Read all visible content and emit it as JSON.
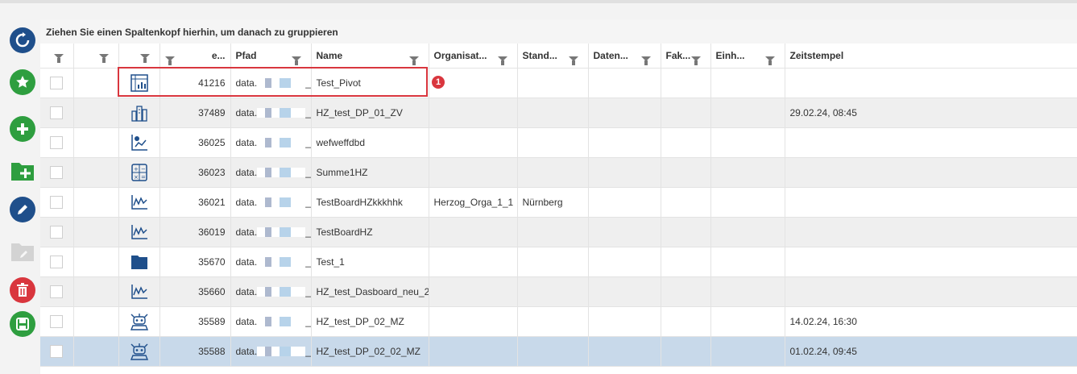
{
  "grid": {
    "group_hint": "Ziehen Sie einen Spaltenkopf hierhin, um danach zu gruppieren",
    "columns": [
      "e...",
      "Pfad",
      "Name",
      "Organisat...",
      "Stand...",
      "Daten...",
      "Fak...",
      "Einh...",
      "Zeitstempel"
    ],
    "rows": [
      {
        "icon": "pivot-table-icon",
        "id": "41216",
        "pfad": "data.",
        "pfad_suffix": "_Test",
        "name": "Test_Pivot",
        "org": "",
        "stand": "",
        "zeit": ""
      },
      {
        "icon": "building-icon",
        "id": "37489",
        "pfad": "data.",
        "pfad_suffix": "_Test",
        "name": "HZ_test_DP_01_ZV",
        "org": "",
        "stand": "",
        "zeit": "29.02.24, 08:45"
      },
      {
        "icon": "scatter-chart-icon",
        "id": "36025",
        "pfad": "data.",
        "pfad_suffix": "_Test",
        "name": "wefweffdbd",
        "org": "",
        "stand": "",
        "zeit": ""
      },
      {
        "icon": "calculator-icon",
        "id": "36023",
        "pfad": "data.",
        "pfad_suffix": "_Test",
        "name": "Summe1HZ",
        "org": "",
        "stand": "",
        "zeit": ""
      },
      {
        "icon": "line-chart-icon",
        "id": "36021",
        "pfad": "data.",
        "pfad_suffix": "_Test",
        "name": "TestBoardHZkkkhhk",
        "org": "Herzog_Orga_1_1",
        "stand": "Nürnberg",
        "zeit": ""
      },
      {
        "icon": "line-chart-icon",
        "id": "36019",
        "pfad": "data.",
        "pfad_suffix": "_Test",
        "name": "TestBoardHZ",
        "org": "",
        "stand": "",
        "zeit": ""
      },
      {
        "icon": "folder-icon",
        "id": "35670",
        "pfad": "data.",
        "pfad_suffix": "_Test",
        "name": "Test_1",
        "org": "",
        "stand": "",
        "zeit": ""
      },
      {
        "icon": "line-chart-icon",
        "id": "35660",
        "pfad": "data.",
        "pfad_suffix": "_Test",
        "name": "HZ_test_Dasboard_neu_2",
        "org": "",
        "stand": "",
        "zeit": ""
      },
      {
        "icon": "robot-icon",
        "id": "35589",
        "pfad": "data.",
        "pfad_suffix": "_Test",
        "name": "HZ_test_DP_02_MZ",
        "org": "",
        "stand": "",
        "zeit": "14.02.24, 16:30"
      },
      {
        "icon": "robot-icon",
        "id": "35588",
        "pfad": "data.",
        "pfad_suffix": "_Test",
        "name": "HZ_test_DP_02_02_MZ",
        "org": "",
        "stand": "",
        "zeit": "01.02.24, 09:45"
      }
    ]
  },
  "annotation": {
    "badge": "1"
  },
  "sidebar": [
    "refresh-icon",
    "favorite-icon",
    "add-icon",
    "add-folder-icon",
    "edit-icon",
    "edit-folder-icon",
    "delete-icon",
    "save-icon"
  ],
  "colors": {
    "accent_blue": "#1f4f8b",
    "green": "#2e9e3f",
    "red": "#d9363e",
    "selected_row": "#c8d9ea"
  }
}
